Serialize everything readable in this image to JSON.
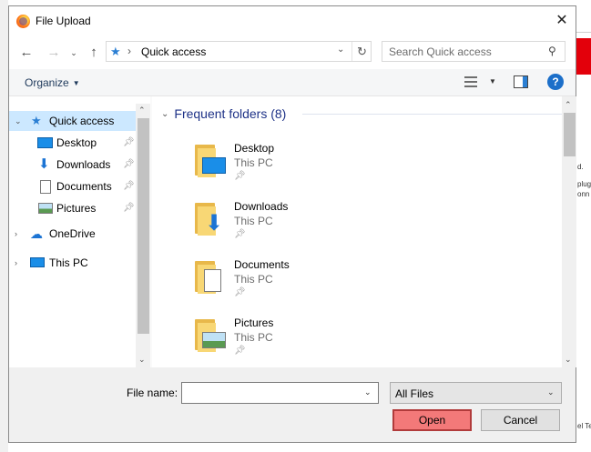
{
  "window": {
    "title": "File Upload"
  },
  "address": {
    "location": "Quick access",
    "search_placeholder": "Search Quick access"
  },
  "toolbar": {
    "organize_label": "Organize"
  },
  "sidebar": {
    "items": [
      {
        "label": "Quick access",
        "pinned": false
      },
      {
        "label": "Desktop",
        "pinned": true
      },
      {
        "label": "Downloads",
        "pinned": true
      },
      {
        "label": "Documents",
        "pinned": true
      },
      {
        "label": "Pictures",
        "pinned": true
      },
      {
        "label": "OneDrive",
        "pinned": false
      },
      {
        "label": "This PC",
        "pinned": false
      }
    ]
  },
  "content": {
    "group_title": "Frequent folders (8)",
    "folders": [
      {
        "name": "Desktop",
        "location": "This PC"
      },
      {
        "name": "Downloads",
        "location": "This PC"
      },
      {
        "name": "Documents",
        "location": "This PC"
      },
      {
        "name": "Pictures",
        "location": "This PC"
      }
    ]
  },
  "footer": {
    "file_name_label": "File name:",
    "file_name_value": "",
    "file_type": "All Files",
    "open_label": "Open",
    "cancel_label": "Cancel"
  },
  "background": {
    "snippets": [
      "d.",
      "plug",
      "onn",
      "el Te"
    ]
  },
  "colors": {
    "selection": "#cce8ff",
    "group_title": "#1e3287",
    "open_button": "#f37979",
    "accent": "#2b7fd3"
  }
}
